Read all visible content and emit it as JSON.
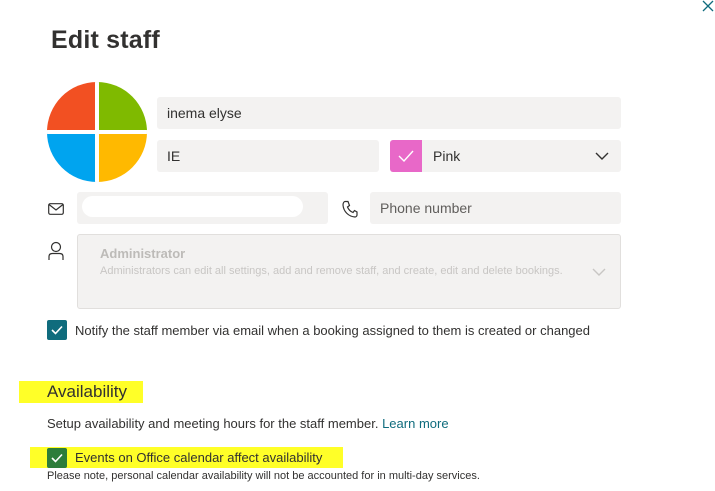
{
  "dialog": {
    "title": "Edit staff",
    "close_icon": "close-icon"
  },
  "staff": {
    "name": "inema elyse",
    "initials": "IE",
    "color": {
      "label": "Pink",
      "swatch_hex": "#e868c8"
    },
    "email": "",
    "phone_placeholder": "Phone number",
    "role": {
      "title": "Administrator",
      "description": "Administrators can edit all settings, add and remove staff, and create, edit and delete bookings."
    },
    "notify": {
      "checked": true,
      "label": "Notify the staff member via email when a booking assigned to them is created or changed"
    }
  },
  "availability": {
    "heading": "Availability",
    "description": "Setup availability and meeting hours for the staff member.",
    "learn_more": "Learn more",
    "events": {
      "checked": true,
      "label": "Events on Office calendar affect availability"
    },
    "note": "Please note, personal calendar availability will not be accounted for in multi-day services."
  },
  "colors": {
    "accent": "#0f6c7d",
    "highlight": "#ffff28",
    "field_bg": "#f3f2f1"
  }
}
